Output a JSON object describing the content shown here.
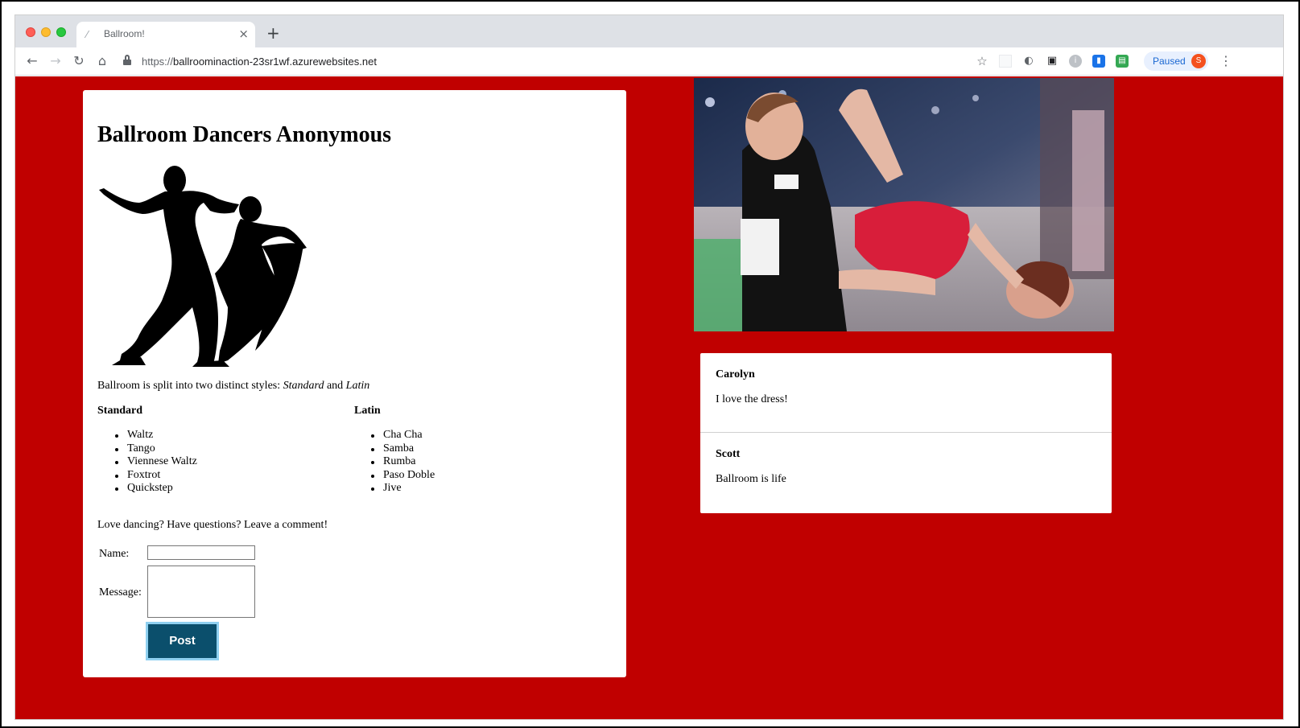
{
  "browser": {
    "tab_title": "Ballroom!",
    "tab_close": "×",
    "new_tab": "+",
    "url_scheme": "https://",
    "url_host": "ballroominaction-23sr1wf.azurewebsites.net",
    "profile_status": "Paused",
    "profile_initial": "S",
    "icons": {
      "back": "back-arrow-icon",
      "forward": "forward-arrow-icon",
      "reload": "reload-icon",
      "home": "home-icon",
      "lock": "lock-icon",
      "bookmark": "star-icon",
      "menu": "kebab-menu-icon"
    }
  },
  "page": {
    "title": "Ballroom Dancers Anonymous",
    "intro_text": "Ballroom is split into two distinct styles:",
    "intro_style_1": "Standard",
    "intro_and": "and",
    "intro_style_2": "Latin",
    "standard": {
      "heading": "Standard",
      "dances": [
        "Waltz",
        "Tango",
        "Viennese Waltz",
        "Foxtrot",
        "Quickstep"
      ]
    },
    "latin": {
      "heading": "Latin",
      "dances": [
        "Cha Cha",
        "Samba",
        "Rumba",
        "Paso Doble",
        "Jive"
      ]
    },
    "invite": "Love dancing? Have questions? Leave a comment!",
    "form": {
      "name_label": "Name:",
      "message_label": "Message:",
      "name_value": "",
      "message_value": "",
      "post_label": "Post"
    }
  },
  "comments": [
    {
      "author": "Carolyn",
      "text": "I love the dress!"
    },
    {
      "author": "Scott",
      "text": "Ballroom is life"
    }
  ],
  "colors": {
    "page_background": "#c00000",
    "post_button": "#0b4f6c",
    "post_button_border": "#8fd0f0"
  }
}
